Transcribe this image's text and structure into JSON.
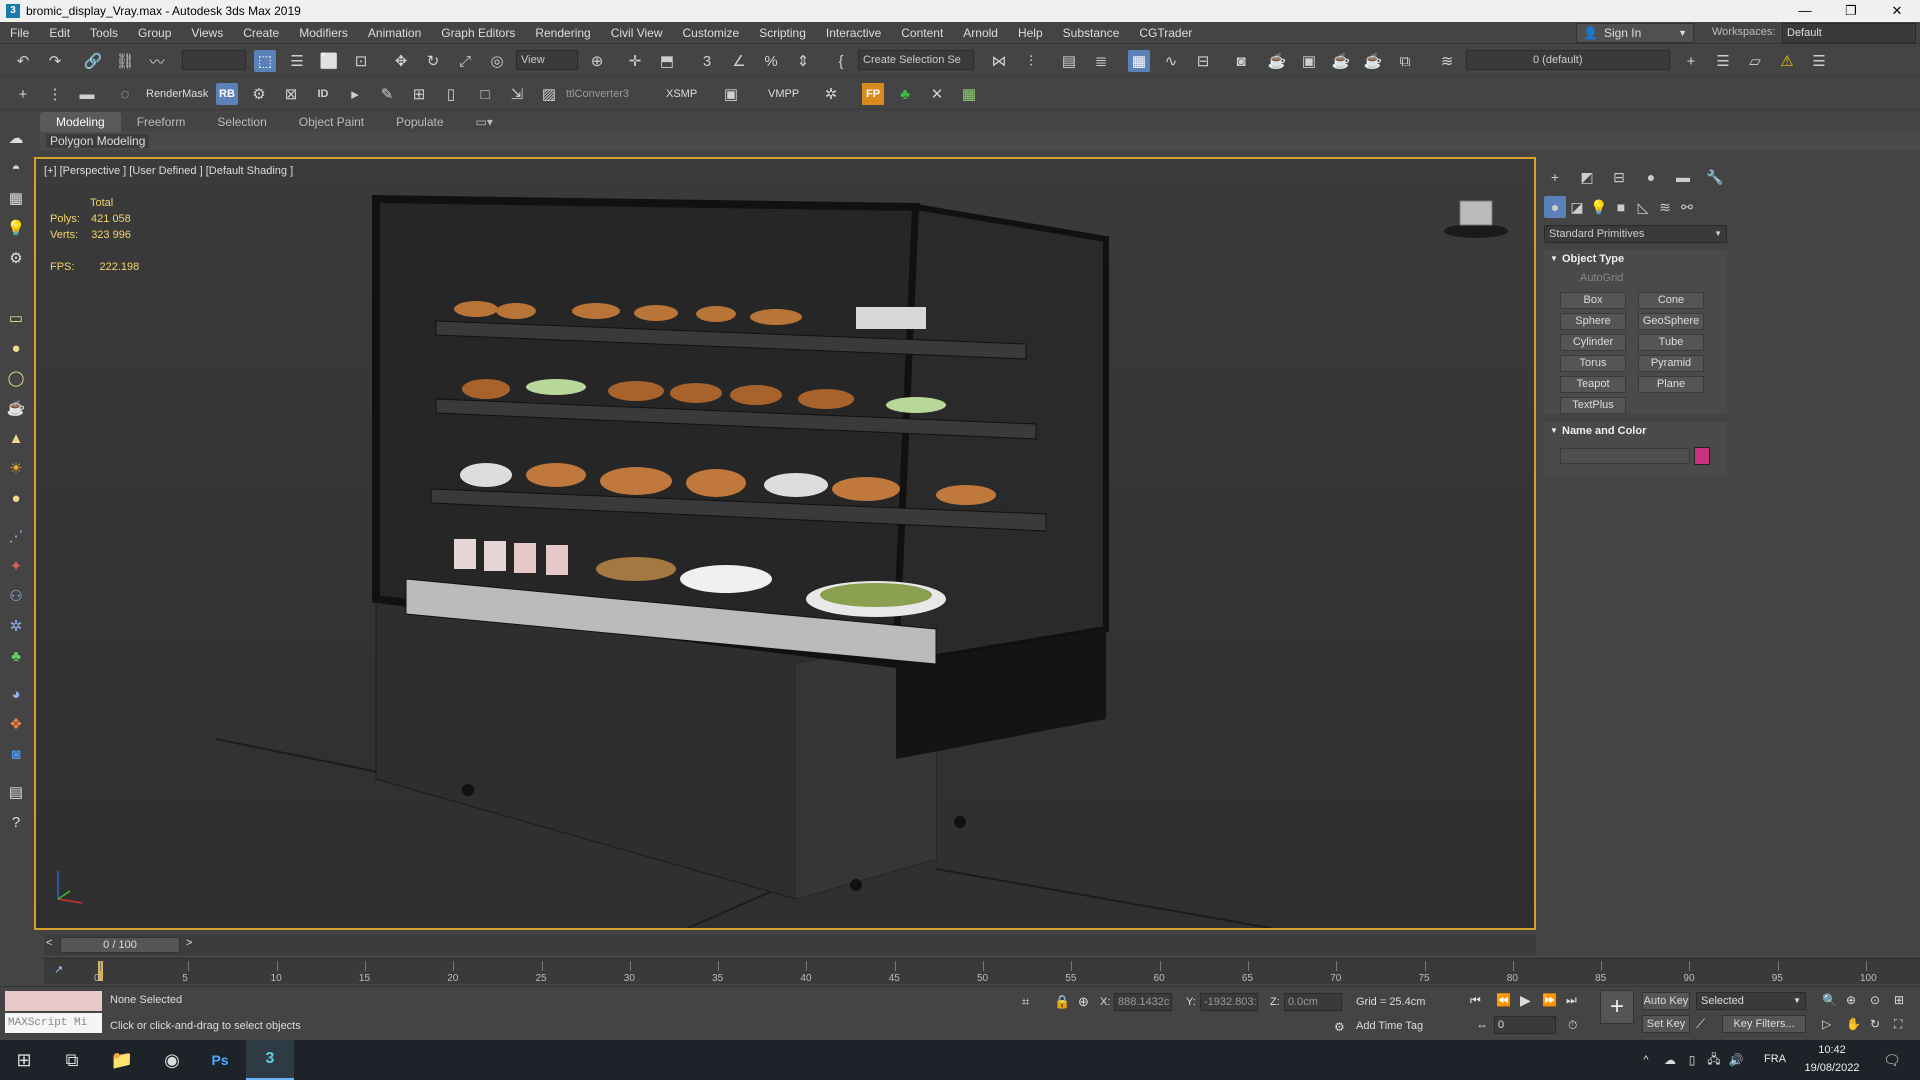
{
  "window": {
    "title": "bromic_display_Vray.max - Autodesk 3ds Max 2019",
    "app_icon": "3",
    "controls": [
      "minimize-icon",
      "restore-icon",
      "close-icon"
    ]
  },
  "menu": [
    "File",
    "Edit",
    "Tools",
    "Group",
    "Views",
    "Create",
    "Modifiers",
    "Animation",
    "Graph Editors",
    "Rendering",
    "Civil View",
    "Customize",
    "Scripting",
    "Interactive",
    "Content",
    "Arnold",
    "Help",
    "Substance",
    "CGTrader"
  ],
  "account": {
    "signin_label": "Sign In",
    "workspace_label": "Workspaces:",
    "workspace_value": "Default"
  },
  "toolbar1": {
    "view_dropdown": "View",
    "selection_set": "Create Selection Se",
    "layer_value": "0 (default)"
  },
  "toolbar2": {
    "rendermask": "RenderMask",
    "rb": "RB",
    "id": "ID",
    "converter": "ttlConverter3",
    "xsmp": "XSMP",
    "vmpp": "VMPP",
    "fp": "FP"
  },
  "ribbon": {
    "tabs": [
      "Modeling",
      "Freeform",
      "Selection",
      "Object Paint",
      "Populate"
    ],
    "active": "Modeling",
    "sub_label": "Polygon Modeling"
  },
  "viewport": {
    "label": "[+] [Perspective ] [User Defined ] [Default Shading ]",
    "stats_header": "Total",
    "polys_label": "Polys:",
    "polys_value": "421 058",
    "verts_label": "Verts:",
    "verts_value": "323 996",
    "fps_label": "FPS:",
    "fps_value": "222.198"
  },
  "command_panel": {
    "category": "Standard Primitives",
    "object_type_header": "Object Type",
    "autogrid": "AutoGrid",
    "buttons": [
      "Box",
      "Cone",
      "Sphere",
      "GeoSphere",
      "Cylinder",
      "Tube",
      "Torus",
      "Pyramid",
      "Teapot",
      "Plane",
      "TextPlus"
    ],
    "name_color_header": "Name and Color",
    "swatch_color": "#c8357e"
  },
  "timeline": {
    "slider": "0 / 100",
    "ticks": [
      "0",
      "5",
      "10",
      "15",
      "20",
      "25",
      "30",
      "35",
      "40",
      "45",
      "50",
      "55",
      "60",
      "65",
      "70",
      "75",
      "80",
      "85",
      "90",
      "95",
      "100"
    ]
  },
  "status": {
    "selection": "None Selected",
    "prompt": "Click or click-and-drag to select objects",
    "listener_placeholder": "MAXScript Mi",
    "x_label": "X:",
    "x_value": "888.1432c",
    "y_label": "Y:",
    "y_value": "-1932.803:",
    "z_label": "Z:",
    "z_value": "0.0cm",
    "grid": "Grid = 25.4cm",
    "add_time_tag": "Add Time Tag",
    "auto_key": "Auto Key",
    "selected": "Selected",
    "set_key": "Set Key",
    "key_filters": "Key Filters...",
    "frame": "0"
  },
  "taskbar": {
    "lang": "FRA",
    "time": "10:42",
    "date": "19/08/2022"
  }
}
